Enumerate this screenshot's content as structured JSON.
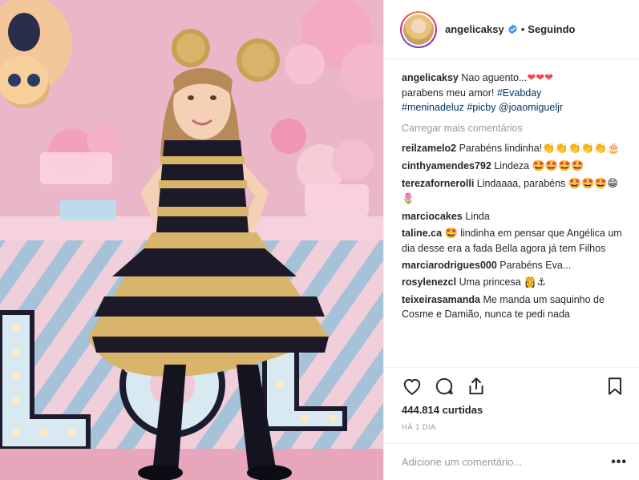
{
  "post": {
    "photo_icon": "party-photo",
    "author": "angelicaksy",
    "verified_icon": "verified-badge-icon",
    "dot": "•",
    "follow_state": "Seguindo"
  },
  "caption": {
    "user": "angelicaksy",
    "text_1": "Nao aguento...",
    "emoji_1": "❤❤❤",
    "text_2": "parabens meu amor!",
    "tag_1": "#Evabday",
    "tag_2": "#meninadeluz",
    "tag_3": "#picby",
    "mention": "@joaomigueljr"
  },
  "load_more_label": "Carregar mais comentários",
  "comments": [
    {
      "user": "reilzamelo2",
      "text": "Parabéns lindinha!",
      "emoji": "👏👏👏👏👏🎂"
    },
    {
      "user": "cinthyamendes792",
      "text": "Lindeza",
      "emoji": "🤩🤩🤩🤩"
    },
    {
      "user": "terezafornerolli",
      "text": "Lindaaaa, parabéns",
      "emoji": "🤩🤩🤩😁🌷"
    },
    {
      "user": "marciocakes",
      "text": "Linda",
      "emoji": ""
    },
    {
      "user": "taline.ca",
      "text": "lindinha em pensar que Angélica um dia desse era a fada Bella agora já tem Filhos",
      "emoji": "🤩"
    },
    {
      "user": "marciarodrigues000",
      "text": "Parabéns Eva...",
      "emoji": ""
    },
    {
      "user": "rosylenezcl",
      "text": "Uma princesa",
      "emoji": "👸⚓"
    },
    {
      "user": "teixeirasamanda",
      "text": "Me manda um saquinho de Cosme e Damião, nunca te pedi nada",
      "emoji": ""
    }
  ],
  "actions": {
    "like_icon": "heart-icon",
    "comment_icon": "comment-bubble-icon",
    "share_icon": "share-icon",
    "save_icon": "bookmark-icon",
    "likes": "444.814 curtidas",
    "time": "HÁ 1 DIA"
  },
  "add_comment": {
    "placeholder": "Adicione um comentário...",
    "more_label": "•••"
  },
  "colors": {
    "tag": "#003569",
    "muted": "#999999",
    "text": "#262626",
    "verified": "#3897f0"
  }
}
